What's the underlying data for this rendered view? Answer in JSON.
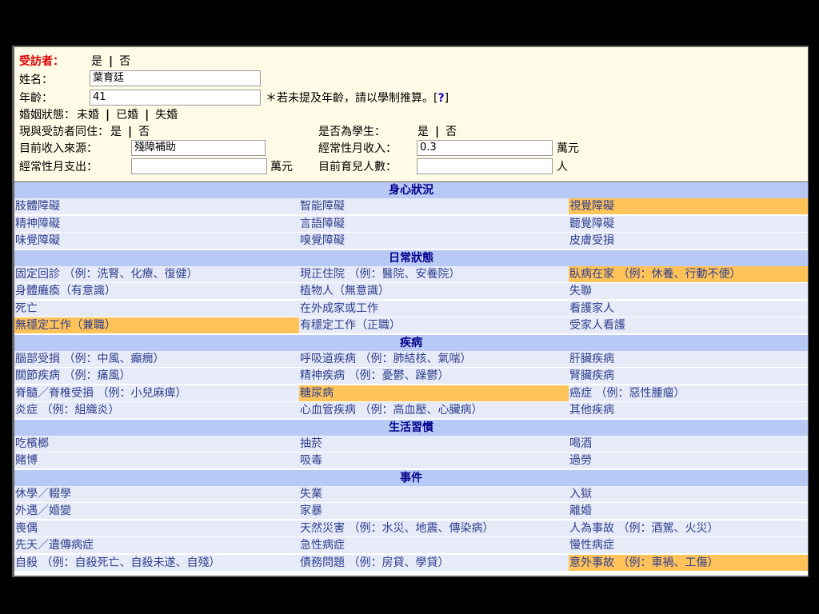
{
  "form": {
    "interviewee_label": "受訪者：",
    "yes": "是",
    "no": "否",
    "name_label": "姓名：",
    "name_value": "葉育廷",
    "age_label": "年齡：",
    "age_value": "41",
    "age_note": "＊若未提及年齡，請以學制推算。[",
    "age_help": "?",
    "age_note_end": "]",
    "marital_label": "婚姻狀態：",
    "marital_options": [
      "未婚",
      "已婚",
      "失婚"
    ],
    "cohabit_label": "現與受訪者同住：",
    "student_label": "是否為學生：",
    "income_source_label": "目前收入來源：",
    "income_source_value": "殘障補助",
    "monthly_income_label": "經常性月收入：",
    "monthly_income_value": "0.3",
    "unit_wan": "萬元",
    "monthly_expense_label": "經常性月支出：",
    "monthly_expense_value": "",
    "children_label": "目前育兒人數：",
    "children_value": "",
    "unit_person": "人"
  },
  "sections": [
    {
      "title": "身心狀況",
      "rows": [
        [
          {
            "text": "肢體障礙"
          },
          {
            "text": "智能障礙"
          },
          {
            "text": "視覺障礙",
            "hl": true
          }
        ],
        [
          {
            "text": "精神障礙"
          },
          {
            "text": "言語障礙"
          },
          {
            "text": "聽覺障礙"
          }
        ],
        [
          {
            "text": "味覺障礙"
          },
          {
            "text": "嗅覺障礙"
          },
          {
            "text": "皮膚受損"
          }
        ]
      ]
    },
    {
      "title": "日常狀態",
      "rows": [
        [
          {
            "text": "固定回診 （例：洗腎、化療、復健）"
          },
          {
            "text": "現正住院 （例：醫院、安養院）"
          },
          {
            "text": "臥病在家 （例：休養、行動不便）",
            "hl": true
          }
        ],
        [
          {
            "text": "身體癱瘓（有意識）"
          },
          {
            "text": "植物人（無意識）"
          },
          {
            "text": "失聯"
          }
        ],
        [
          {
            "text": "死亡"
          },
          {
            "text": "在外成家或工作"
          },
          {
            "text": "看護家人"
          }
        ],
        [
          {
            "text": "無穩定工作（兼職）",
            "hl": true
          },
          {
            "text": "有穩定工作（正職）"
          },
          {
            "text": "受家人看護"
          }
        ]
      ]
    },
    {
      "title": "疾病",
      "rows": [
        [
          {
            "text": "腦部受損 （例：中風、癲癇）"
          },
          {
            "text": "呼吸道疾病 （例：肺結核、氣喘）"
          },
          {
            "text": "肝臟疾病"
          }
        ],
        [
          {
            "text": "關節疾病 （例：痛風）"
          },
          {
            "text": "精神疾病 （例：憂鬱、躁鬱）"
          },
          {
            "text": "腎臟疾病"
          }
        ],
        [
          {
            "text": "脊髓／脊椎受損 （例：小兒麻痺）"
          },
          {
            "text": "糖尿病",
            "hl": true
          },
          {
            "text": "癌症 （例：惡性腫瘤）"
          }
        ],
        [
          {
            "text": "炎症 （例：組織炎）"
          },
          {
            "text": "心血管疾病 （例：高血壓、心臟病）"
          },
          {
            "text": "其他疾病"
          }
        ]
      ]
    },
    {
      "title": "生活習慣",
      "rows": [
        [
          {
            "text": "吃檳榔"
          },
          {
            "text": "抽菸"
          },
          {
            "text": "喝酒"
          }
        ],
        [
          {
            "text": "賭博"
          },
          {
            "text": "吸毒"
          },
          {
            "text": "過勞"
          }
        ]
      ]
    },
    {
      "title": "事件",
      "rows": [
        [
          {
            "text": "休學／輟學"
          },
          {
            "text": "失業"
          },
          {
            "text": "入獄"
          }
        ],
        [
          {
            "text": "外遇／婚變"
          },
          {
            "text": "家暴"
          },
          {
            "text": "離婚"
          }
        ],
        [
          {
            "text": "喪偶"
          },
          {
            "text": "天然災害 （例：水災、地震、傳染病）"
          },
          {
            "text": "人為事故 （例：酒駕、火災）"
          }
        ],
        [
          {
            "text": "先天／遺傳病症"
          },
          {
            "text": "急性病症"
          },
          {
            "text": "慢性病症"
          }
        ],
        [
          {
            "text": "自殺 （例：自殺死亡、自殺未遂、自殘）"
          },
          {
            "text": "債務問題 （例：房貸、學貸）"
          },
          {
            "text": "意外事故 （例：車禍、工傷）",
            "hl": true
          }
        ]
      ]
    }
  ]
}
